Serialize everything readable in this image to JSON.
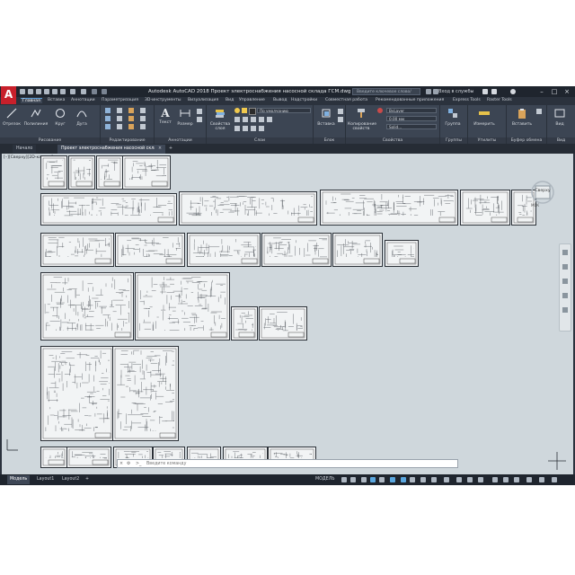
{
  "app": {
    "title": "Autodesk AutoCAD 2018   Проект электроснабжения насосной склада ГСМ.dwg",
    "search_placeholder": "Введите ключевое слово/фразу",
    "user": "Вход в службы",
    "logo": "A"
  },
  "ribbon_tabs": [
    "Главная",
    "Вставка",
    "Аннотации",
    "Параметризация",
    "3D-инструменты",
    "Визуализация",
    "Вид",
    "Управление",
    "Вывод",
    "Надстройки",
    "Совместная работа",
    "Рекомендованные приложения",
    "Express Tools",
    "Raster Tools"
  ],
  "ribbon": {
    "draw": {
      "line": "Отрезок",
      "polyline": "Полилиния",
      "circle": "Круг",
      "arc": "Дуга",
      "label": "Рисование"
    },
    "modify": {
      "label": "Редактирование"
    },
    "annotation": {
      "text": "Текст",
      "dimension": "Размер",
      "label": "Аннотации"
    },
    "layers": {
      "props": "Свойства слоя",
      "layer_combo": "По умолчанию",
      "label": "Слои"
    },
    "block": {
      "insert": "Вставка",
      "label": "Блок"
    },
    "properties": {
      "match": "Копирование свойств",
      "color": "ByLayer",
      "lineweight": "0.00 мм",
      "linetype": "Solid...",
      "label": "Свойства"
    },
    "groups": {
      "group": "Группа",
      "label": "Группы"
    },
    "utilities": {
      "measure": "Измерить",
      "label": "Утилиты"
    },
    "clipboard": {
      "paste": "Вставить",
      "label": "Буфер обмена"
    },
    "view": {
      "base": "Вид",
      "label": "Вид"
    }
  },
  "file_tabs": {
    "start": "Начало",
    "file": "Проект электроснабжения насосной склада ГСМ*"
  },
  "viewport": {
    "label": "[–][Сверху][2D-каркас]",
    "viewcube_top": "Сверху",
    "viewcube_compass": "МСК"
  },
  "command": {
    "placeholder": "Введите команду"
  },
  "status": {
    "model": "Модель",
    "layout1": "Layout1",
    "layout2": "Layout2",
    "mode": "МОДЕЛЬ"
  }
}
